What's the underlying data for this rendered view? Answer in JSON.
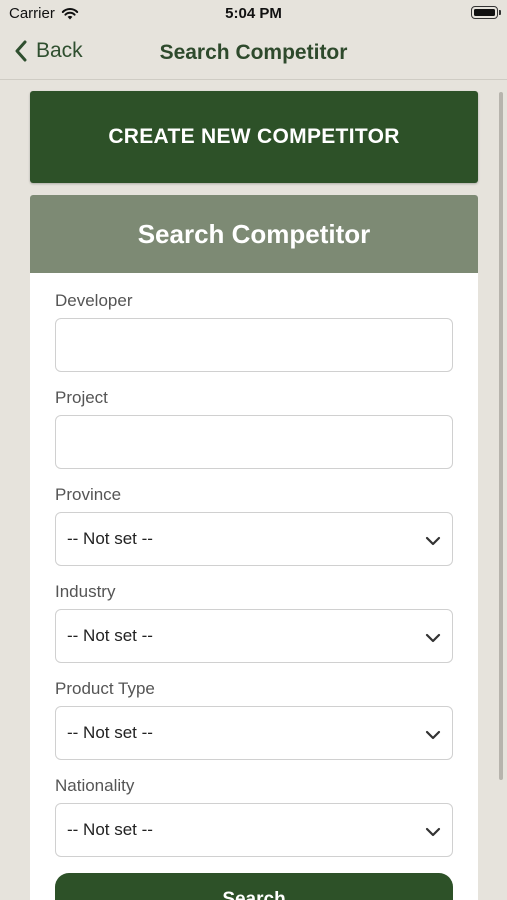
{
  "status_bar": {
    "carrier": "Carrier",
    "time": "5:04 PM",
    "icons": [
      "wifi-icon",
      "battery-icon"
    ]
  },
  "nav": {
    "back_label": "Back",
    "title": "Search Competitor",
    "back_icon": "chevron-left-icon"
  },
  "create_button": {
    "label": "CREATE NEW COMPETITOR"
  },
  "panel": {
    "title": "Search Competitor",
    "fields": {
      "developer": {
        "label": "Developer",
        "value": "",
        "placeholder": ""
      },
      "project": {
        "label": "Project",
        "value": "",
        "placeholder": ""
      },
      "province": {
        "label": "Province",
        "value": "-- Not set --"
      },
      "industry": {
        "label": "Industry",
        "value": "-- Not set --"
      },
      "product_type": {
        "label": "Product Type",
        "value": "-- Not set --"
      },
      "nationality": {
        "label": "Nationality",
        "value": "-- Not set --"
      }
    },
    "search_label": "Search"
  },
  "colors": {
    "background": "#e6e3dc",
    "primary": "#2d5128",
    "header": "#7d8a74",
    "nav_title": "#2e4a2c"
  }
}
